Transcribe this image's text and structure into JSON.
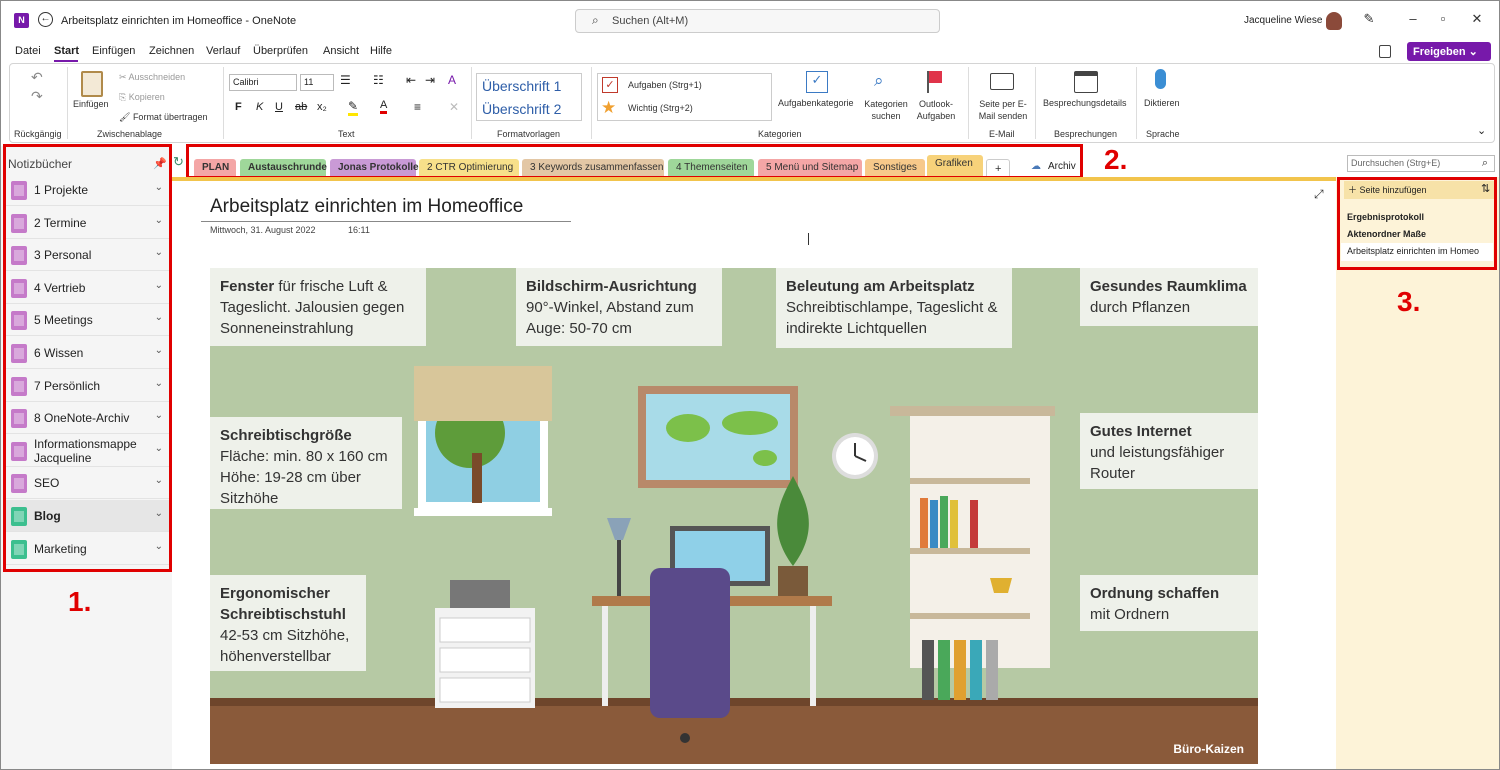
{
  "window": {
    "title": "Arbeitsplatz einrichten im Homeoffice - OneNote",
    "search_placeholder": "Suchen (Alt+M)",
    "user": "Jacqueline Wiese"
  },
  "menu": [
    "Datei",
    "Start",
    "Einfügen",
    "Zeichnen",
    "Verlauf",
    "Überprüfen",
    "Ansicht",
    "Hilfe"
  ],
  "share_label": "Freigeben",
  "ribbon": {
    "undo_group": "Rückgängig",
    "clipboard": {
      "paste": "Einfügen",
      "cut": "Ausschneiden",
      "copy": "Kopieren",
      "format": "Format übertragen",
      "label": "Zwischenablage"
    },
    "text": {
      "font": "Calibri",
      "size": "11",
      "label": "Text"
    },
    "styles": {
      "h1": "Überschrift 1",
      "h2": "Überschrift 2",
      "label": "Formatvorlagen"
    },
    "tags": {
      "todo": "Aufgaben (Strg+1)",
      "important": "Wichtig (Strg+2)",
      "tag_cat": "Aufgabenkategorie",
      "find_tags": "Kategorien suchen",
      "outlook": "Outlook-Aufgaben",
      "label": "Kategorien"
    },
    "email": {
      "send": "Seite per E-Mail senden",
      "label": "E-Mail"
    },
    "meetings": {
      "details": "Besprechungsdetails",
      "label": "Besprechungen"
    },
    "voice": {
      "dictate": "Diktieren",
      "label": "Sprache"
    }
  },
  "notebooks": {
    "header": "Notizbücher",
    "items": [
      {
        "label": "1 Projekte",
        "color": "#c57ac9"
      },
      {
        "label": "2 Termine",
        "color": "#c57ac9"
      },
      {
        "label": "3 Personal",
        "color": "#c57ac9"
      },
      {
        "label": "4 Vertrieb",
        "color": "#c57ac9"
      },
      {
        "label": "5 Meetings",
        "color": "#c57ac9"
      },
      {
        "label": "6 Wissen",
        "color": "#c57ac9"
      },
      {
        "label": "7 Persönlich",
        "color": "#c57ac9"
      },
      {
        "label": "8 OneNote-Archiv",
        "color": "#c57ac9"
      },
      {
        "label": "Informationsmappe Jacqueline",
        "color": "#c57ac9"
      },
      {
        "label": "SEO",
        "color": "#c57ac9"
      },
      {
        "label": "Blog",
        "color": "#3cbf8f"
      },
      {
        "label": "Marketing",
        "color": "#3cbf8f"
      }
    ]
  },
  "sections": [
    {
      "label": "PLAN",
      "color": "#f4a6a6"
    },
    {
      "label": "Austauschrunde",
      "color": "#9fd79a"
    },
    {
      "label": "Jonas Protokolle",
      "color": "#c99ad6"
    },
    {
      "label": "2 CTR Optimierung",
      "color": "#f7e08a"
    },
    {
      "label": "3 Keywords zusammenfassen",
      "color": "#e3c7a5"
    },
    {
      "label": "4 Themenseiten",
      "color": "#9fd79a"
    },
    {
      "label": "5 Menü und Sitemap",
      "color": "#f4a6a6"
    },
    {
      "label": "Sonstiges",
      "color": "#f7c98a"
    },
    {
      "label": "Grafiken",
      "color": "#f7d27a"
    }
  ],
  "archive_label": "Archiv",
  "section_search_placeholder": "Durchsuchen (Strg+E)",
  "pages": {
    "add_label": "Seite hinzufügen",
    "items": [
      "Ergebnisprotokoll",
      "Aktenordner Maße",
      "Arbeitsplatz einrichten im Homeo"
    ]
  },
  "page": {
    "title": "Arbeitsplatz einrichten im Homeoffice",
    "date": "Mittwoch, 31. August 2022",
    "time": "16:11"
  },
  "infographic": {
    "cards": [
      {
        "head": "Fenster",
        "body": " für frische Luft & Tageslicht. Jalousien gegen Sonneneinstrahlung"
      },
      {
        "head": "Bildschirm-Ausrichtung",
        "body": "90°-Winkel, Abstand zum Auge: 50-70 cm"
      },
      {
        "head": "Beleutung am Arbeitsplatz",
        "body": "Schreibtischlampe, Tageslicht & indirekte Lichtquellen"
      },
      {
        "head": "Gesundes Raumklima",
        "body": "durch Pflanzen"
      },
      {
        "head": "Schreibtischgröße",
        "body": "Fläche: min. 80 x 160 cm Höhe: 19-28 cm über Sitzhöhe"
      },
      {
        "head": "Gutes Internet",
        "body": "und leistungsfähiger Router"
      },
      {
        "head": "Ergonomischer Schreibtischstuhl",
        "body": "42-53 cm Sitzhöhe, höhenverstellbar"
      },
      {
        "head": "Ordnung schaffen",
        "body": "mit Ordnern"
      }
    ],
    "brand": "Büro-Kaizen"
  },
  "annotations": [
    "1.",
    "2.",
    "3."
  ]
}
